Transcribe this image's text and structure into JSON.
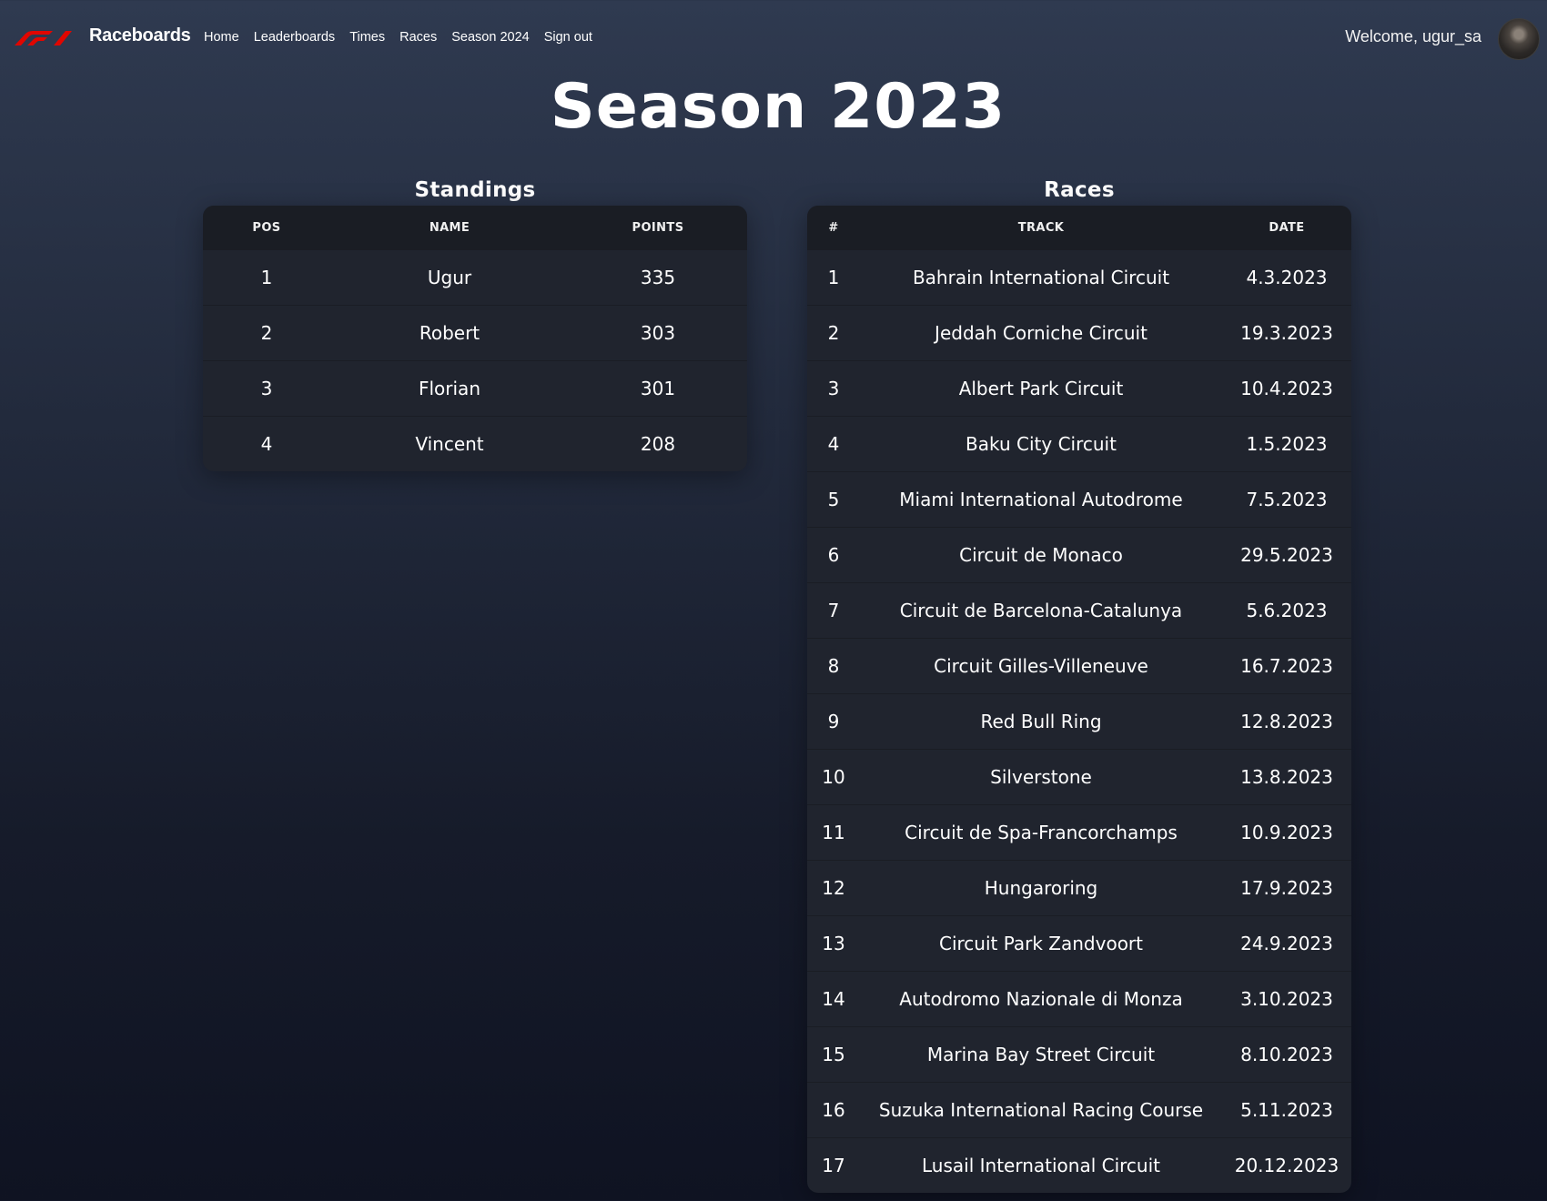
{
  "nav": {
    "brand": "Raceboards",
    "links": [
      "Home",
      "Leaderboards",
      "Times",
      "Races",
      "Season 2024",
      "Sign out"
    ],
    "welcome": "Welcome, ugur_sa",
    "accent_color": "#e10600"
  },
  "page": {
    "title": "Season 2023"
  },
  "standings": {
    "title": "Standings",
    "headers": [
      "POS",
      "NAME",
      "POINTS"
    ],
    "rows": [
      {
        "pos": "1",
        "name": "Ugur",
        "points": "335"
      },
      {
        "pos": "2",
        "name": "Robert",
        "points": "303"
      },
      {
        "pos": "3",
        "name": "Florian",
        "points": "301"
      },
      {
        "pos": "4",
        "name": "Vincent",
        "points": "208"
      }
    ]
  },
  "races": {
    "title": "Races",
    "headers": [
      "#",
      "TRACK",
      "DATE"
    ],
    "rows": [
      {
        "num": "1",
        "track": "Bahrain International Circuit",
        "date": "4.3.2023"
      },
      {
        "num": "2",
        "track": "Jeddah Corniche Circuit",
        "date": "19.3.2023"
      },
      {
        "num": "3",
        "track": "Albert Park Circuit",
        "date": "10.4.2023"
      },
      {
        "num": "4",
        "track": "Baku City Circuit",
        "date": "1.5.2023"
      },
      {
        "num": "5",
        "track": "Miami International Autodrome",
        "date": "7.5.2023"
      },
      {
        "num": "6",
        "track": "Circuit de Monaco",
        "date": "29.5.2023"
      },
      {
        "num": "7",
        "track": "Circuit de Barcelona-Catalunya",
        "date": "5.6.2023"
      },
      {
        "num": "8",
        "track": "Circuit Gilles-Villeneuve",
        "date": "16.7.2023"
      },
      {
        "num": "9",
        "track": "Red Bull Ring",
        "date": "12.8.2023"
      },
      {
        "num": "10",
        "track": "Silverstone",
        "date": "13.8.2023"
      },
      {
        "num": "11",
        "track": "Circuit de Spa-Francorchamps",
        "date": "10.9.2023"
      },
      {
        "num": "12",
        "track": "Hungaroring",
        "date": "17.9.2023"
      },
      {
        "num": "13",
        "track": "Circuit Park Zandvoort",
        "date": "24.9.2023"
      },
      {
        "num": "14",
        "track": "Autodromo Nazionale di Monza",
        "date": "3.10.2023"
      },
      {
        "num": "15",
        "track": "Marina Bay Street Circuit",
        "date": "8.10.2023"
      },
      {
        "num": "16",
        "track": "Suzuka International Racing Course",
        "date": "5.11.2023"
      },
      {
        "num": "17",
        "track": "Lusail International Circuit",
        "date": "20.12.2023"
      }
    ]
  }
}
